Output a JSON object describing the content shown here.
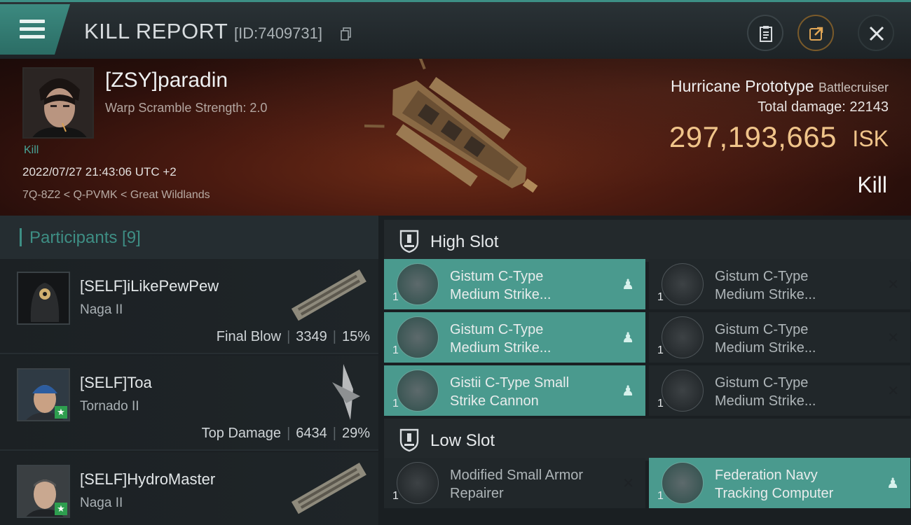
{
  "header": {
    "title": "KILL REPORT",
    "report_id": "[ID:7409731]"
  },
  "victim": {
    "name": "[ZSY]paradin",
    "warp_scramble": "Warp Scramble Strength: 2.0",
    "kill_tag": "Kill",
    "datetime": "2022/07/27 21:43:06 UTC +2",
    "location": "7Q-8Z2 < Q-PVMK < Great Wildlands",
    "ship_name": "Hurricane Prototype",
    "ship_class": "Battlecruiser",
    "total_damage_label": "Total damage:",
    "total_damage": "22143",
    "isk_value": "297,193,665",
    "isk_unit": "ISK",
    "result": "Kill"
  },
  "participants": {
    "label": "Participants [9]",
    "rows": [
      {
        "name": "[SELF]iLikePewPew",
        "ship": "Naga II",
        "role": "Final Blow",
        "damage": "3349",
        "percent": "15%"
      },
      {
        "name": "[SELF]Toa",
        "ship": "Tornado II",
        "role": "Top Damage",
        "damage": "6434",
        "percent": "29%"
      },
      {
        "name": "[SELF]HydroMaster",
        "ship": "Naga II",
        "role": "",
        "damage": "",
        "percent": ""
      }
    ]
  },
  "high_slot": {
    "label": "High Slot",
    "modules": [
      {
        "line1": "Gistum C-Type",
        "line2": "Medium Strike...",
        "qty": "1",
        "dropped": true
      },
      {
        "line1": "Gistum C-Type",
        "line2": "Medium Strike...",
        "qty": "1",
        "dropped": false
      },
      {
        "line1": "Gistum C-Type",
        "line2": "Medium Strike...",
        "qty": "1",
        "dropped": true
      },
      {
        "line1": "Gistum C-Type",
        "line2": "Medium Strike...",
        "qty": "1",
        "dropped": false
      },
      {
        "line1": "Gistii C-Type Small",
        "line2": "Strike Cannon",
        "qty": "1",
        "dropped": true
      },
      {
        "line1": "Gistum C-Type",
        "line2": "Medium Strike...",
        "qty": "1",
        "dropped": false
      }
    ]
  },
  "low_slot": {
    "label": "Low Slot",
    "modules": [
      {
        "line1": "Modified Small Armor",
        "line2": "Repairer",
        "qty": "1",
        "dropped": false
      },
      {
        "line1": "Federation Navy",
        "line2": "Tracking Computer",
        "qty": "1",
        "dropped": true
      }
    ]
  },
  "icons": {
    "menu": "hamburger-icon",
    "copy": "copy-icon",
    "clipboard": "clipboard-icon",
    "share": "share-icon",
    "close": "close-icon",
    "dropped": "person-icon",
    "destroyed": "x-icon",
    "slot": "shield-icon"
  },
  "colors": {
    "accent": "#3d8f85",
    "isk": "#f0c48a",
    "highlight_module": "#4a9a8e"
  }
}
